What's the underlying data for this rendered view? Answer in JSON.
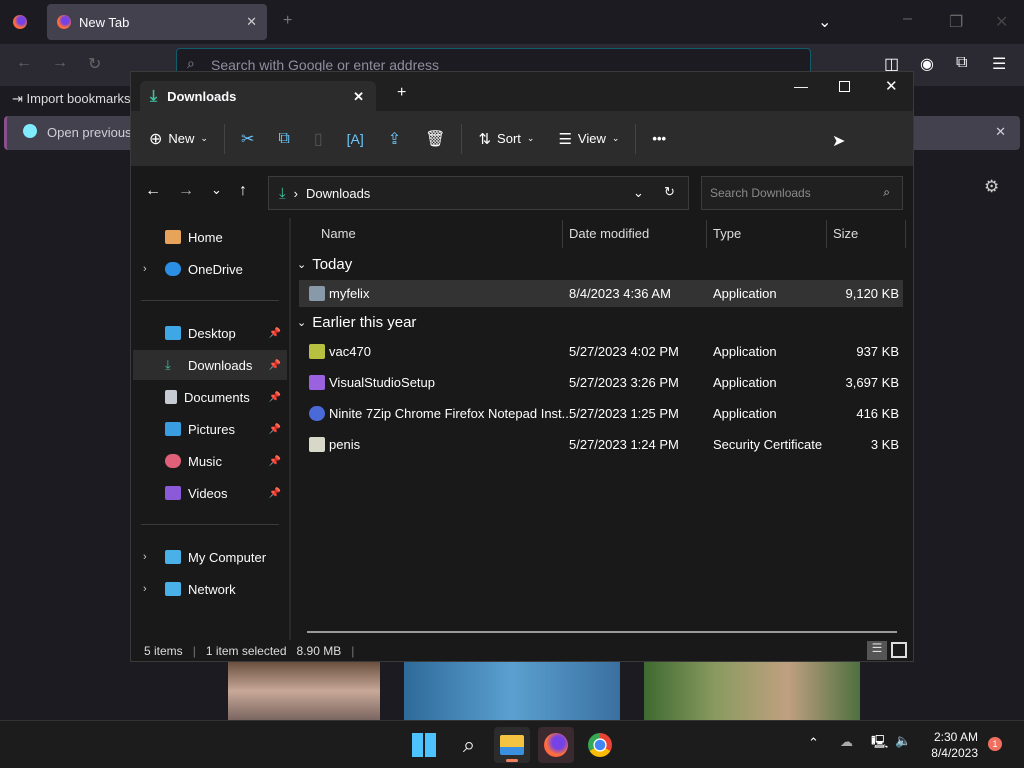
{
  "browser": {
    "tab_title": "New Tab",
    "url_placeholder": "Search with Google or enter address",
    "import_bookmarks": "Import bookmarks",
    "notification": "Open previous t"
  },
  "explorer": {
    "tab_title": "Downloads",
    "toolbar": {
      "new": "New",
      "sort": "Sort",
      "view": "View",
      "more": "•••"
    },
    "breadcrumb": "Downloads",
    "search_placeholder": "Search Downloads",
    "nav": {
      "home": "Home",
      "onedrive": "OneDrive",
      "desktop": "Desktop",
      "downloads": "Downloads",
      "documents": "Documents",
      "pictures": "Pictures",
      "music": "Music",
      "videos": "Videos",
      "computer": "My Computer",
      "network": "Network"
    },
    "columns": {
      "name": "Name",
      "date": "Date modified",
      "type": "Type",
      "size": "Size"
    },
    "groups": {
      "today": "Today",
      "earlier": "Earlier this year"
    },
    "files": [
      {
        "name": "myfelix",
        "date": "8/4/2023 4:36 AM",
        "type": "Application",
        "size": "9,120 KB"
      },
      {
        "name": "vac470",
        "date": "5/27/2023 4:02 PM",
        "type": "Application",
        "size": "937 KB"
      },
      {
        "name": "VisualStudioSetup",
        "date": "5/27/2023 3:26 PM",
        "type": "Application",
        "size": "3,697 KB"
      },
      {
        "name": "Ninite 7Zip Chrome Firefox Notepad Inst...",
        "date": "5/27/2023 1:25 PM",
        "type": "Application",
        "size": "416 KB"
      },
      {
        "name": "penis",
        "date": "5/27/2023 1:24 PM",
        "type": "Security Certificate",
        "size": "3 KB"
      }
    ],
    "status": {
      "items": "5 items",
      "selected": "1 item selected",
      "size": "8.90 MB"
    }
  },
  "taskbar": {
    "time": "2:30 AM",
    "date": "8/4/2023",
    "badge": "1"
  }
}
